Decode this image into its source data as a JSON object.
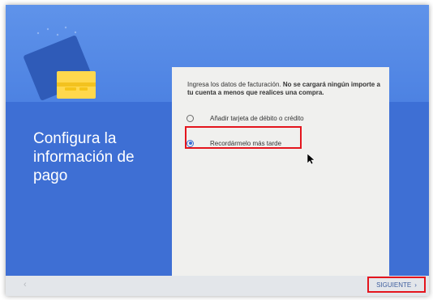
{
  "setup": {
    "title": "Configura la información de pago",
    "description_prefix": "Ingresa los datos de facturación. ",
    "description_bold": "No se cargará ningún importe a tu cuenta a menos que realices una compra.",
    "options": [
      {
        "label": "Añadir tarjeta de débito o crédito",
        "selected": false
      },
      {
        "label": "Recordármelo más tarde",
        "selected": true
      }
    ]
  },
  "footer": {
    "back_icon": "chevron-left-icon",
    "next_label": "SIGUIENTE",
    "next_icon": "chevron-right-icon"
  },
  "colors": {
    "hero_blue": "#3e6fd4",
    "card_yellow": "#ffd84d",
    "highlight_red": "#e4151d",
    "panel_bg": "#f0f0ee",
    "radio_blue": "#3b6fd6"
  }
}
